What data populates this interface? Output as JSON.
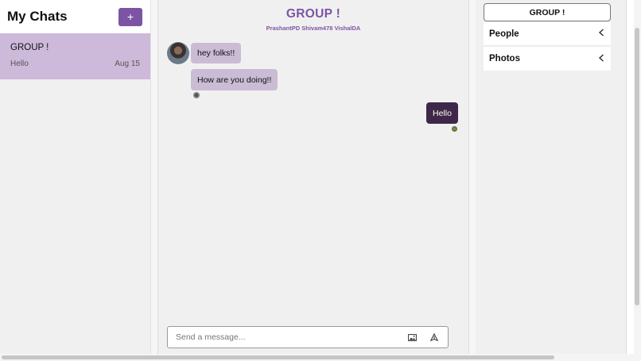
{
  "sidebar": {
    "title": "My Chats",
    "add_label": "+",
    "chats": [
      {
        "name": "GROUP !",
        "last_message": "Hello",
        "date": "Aug 15"
      }
    ]
  },
  "chat": {
    "title": "GROUP !",
    "members": "PrashantPD Shivam478 VishalDA",
    "messages": [
      {
        "text": "hey folks!!",
        "own": false
      },
      {
        "text": "How are you doing!!",
        "own": false
      },
      {
        "text": "Hello",
        "own": true
      }
    ],
    "composer": {
      "placeholder": "Send a message..."
    }
  },
  "details": {
    "title": "GROUP !",
    "sections": [
      {
        "label": "People"
      },
      {
        "label": "Photos"
      }
    ]
  },
  "colors": {
    "accent": "#7b55a3",
    "bubble_other": "#cbbcd6",
    "bubble_own": "#3e2748",
    "selected_chat": "#cdb9da"
  }
}
